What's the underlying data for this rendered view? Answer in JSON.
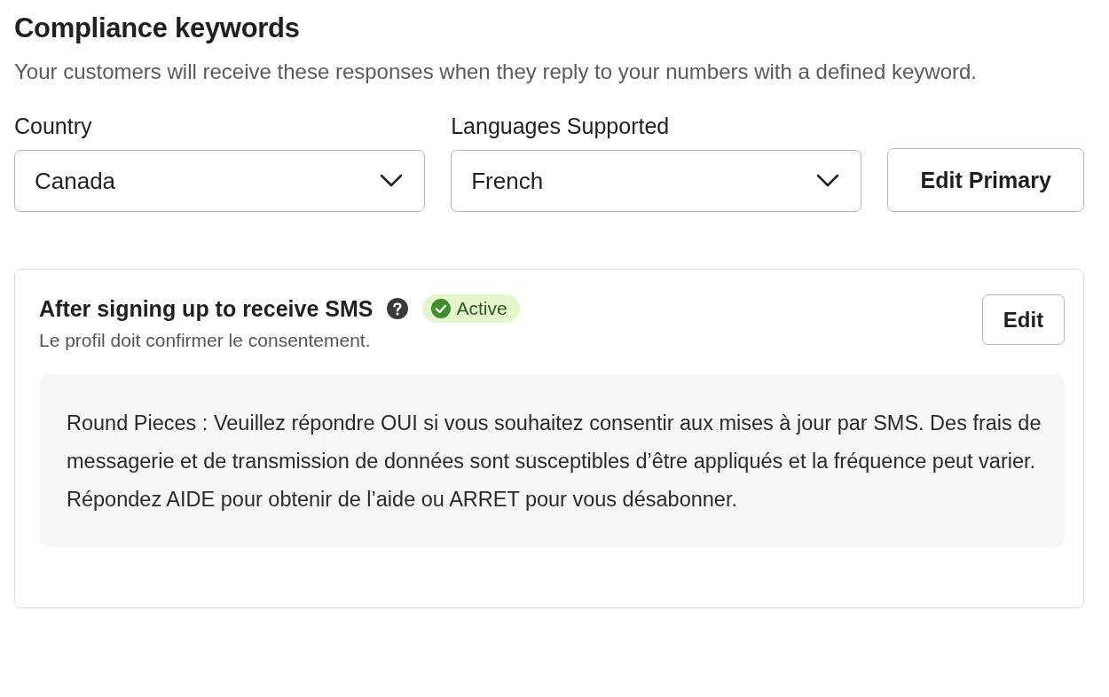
{
  "header": {
    "title": "Compliance keywords",
    "description": "Your customers will receive these responses when they reply to your numbers with a defined keyword."
  },
  "filters": [
    {
      "label": "Country",
      "value": "Canada"
    },
    {
      "label": "Languages Supported",
      "value": "French"
    }
  ],
  "edit_primary_button": "Edit Primary",
  "keyword_card": {
    "title": "After signing up to receive SMS",
    "status": {
      "label": "Active",
      "active": true
    },
    "subtitle": "Le profil doit confirmer le consentement.",
    "edit_button": "Edit",
    "message": "Round Pieces : Veuillez répondre OUI si vous souhaitez consentir aux mises à jour par SMS. Des frais de messagerie et de transmission de données sont susceptibles d’être appliqués et la fréquence peut varier. Répondez AIDE pour obtenir de l’aide ou ARRET pour vous désabonner."
  }
}
